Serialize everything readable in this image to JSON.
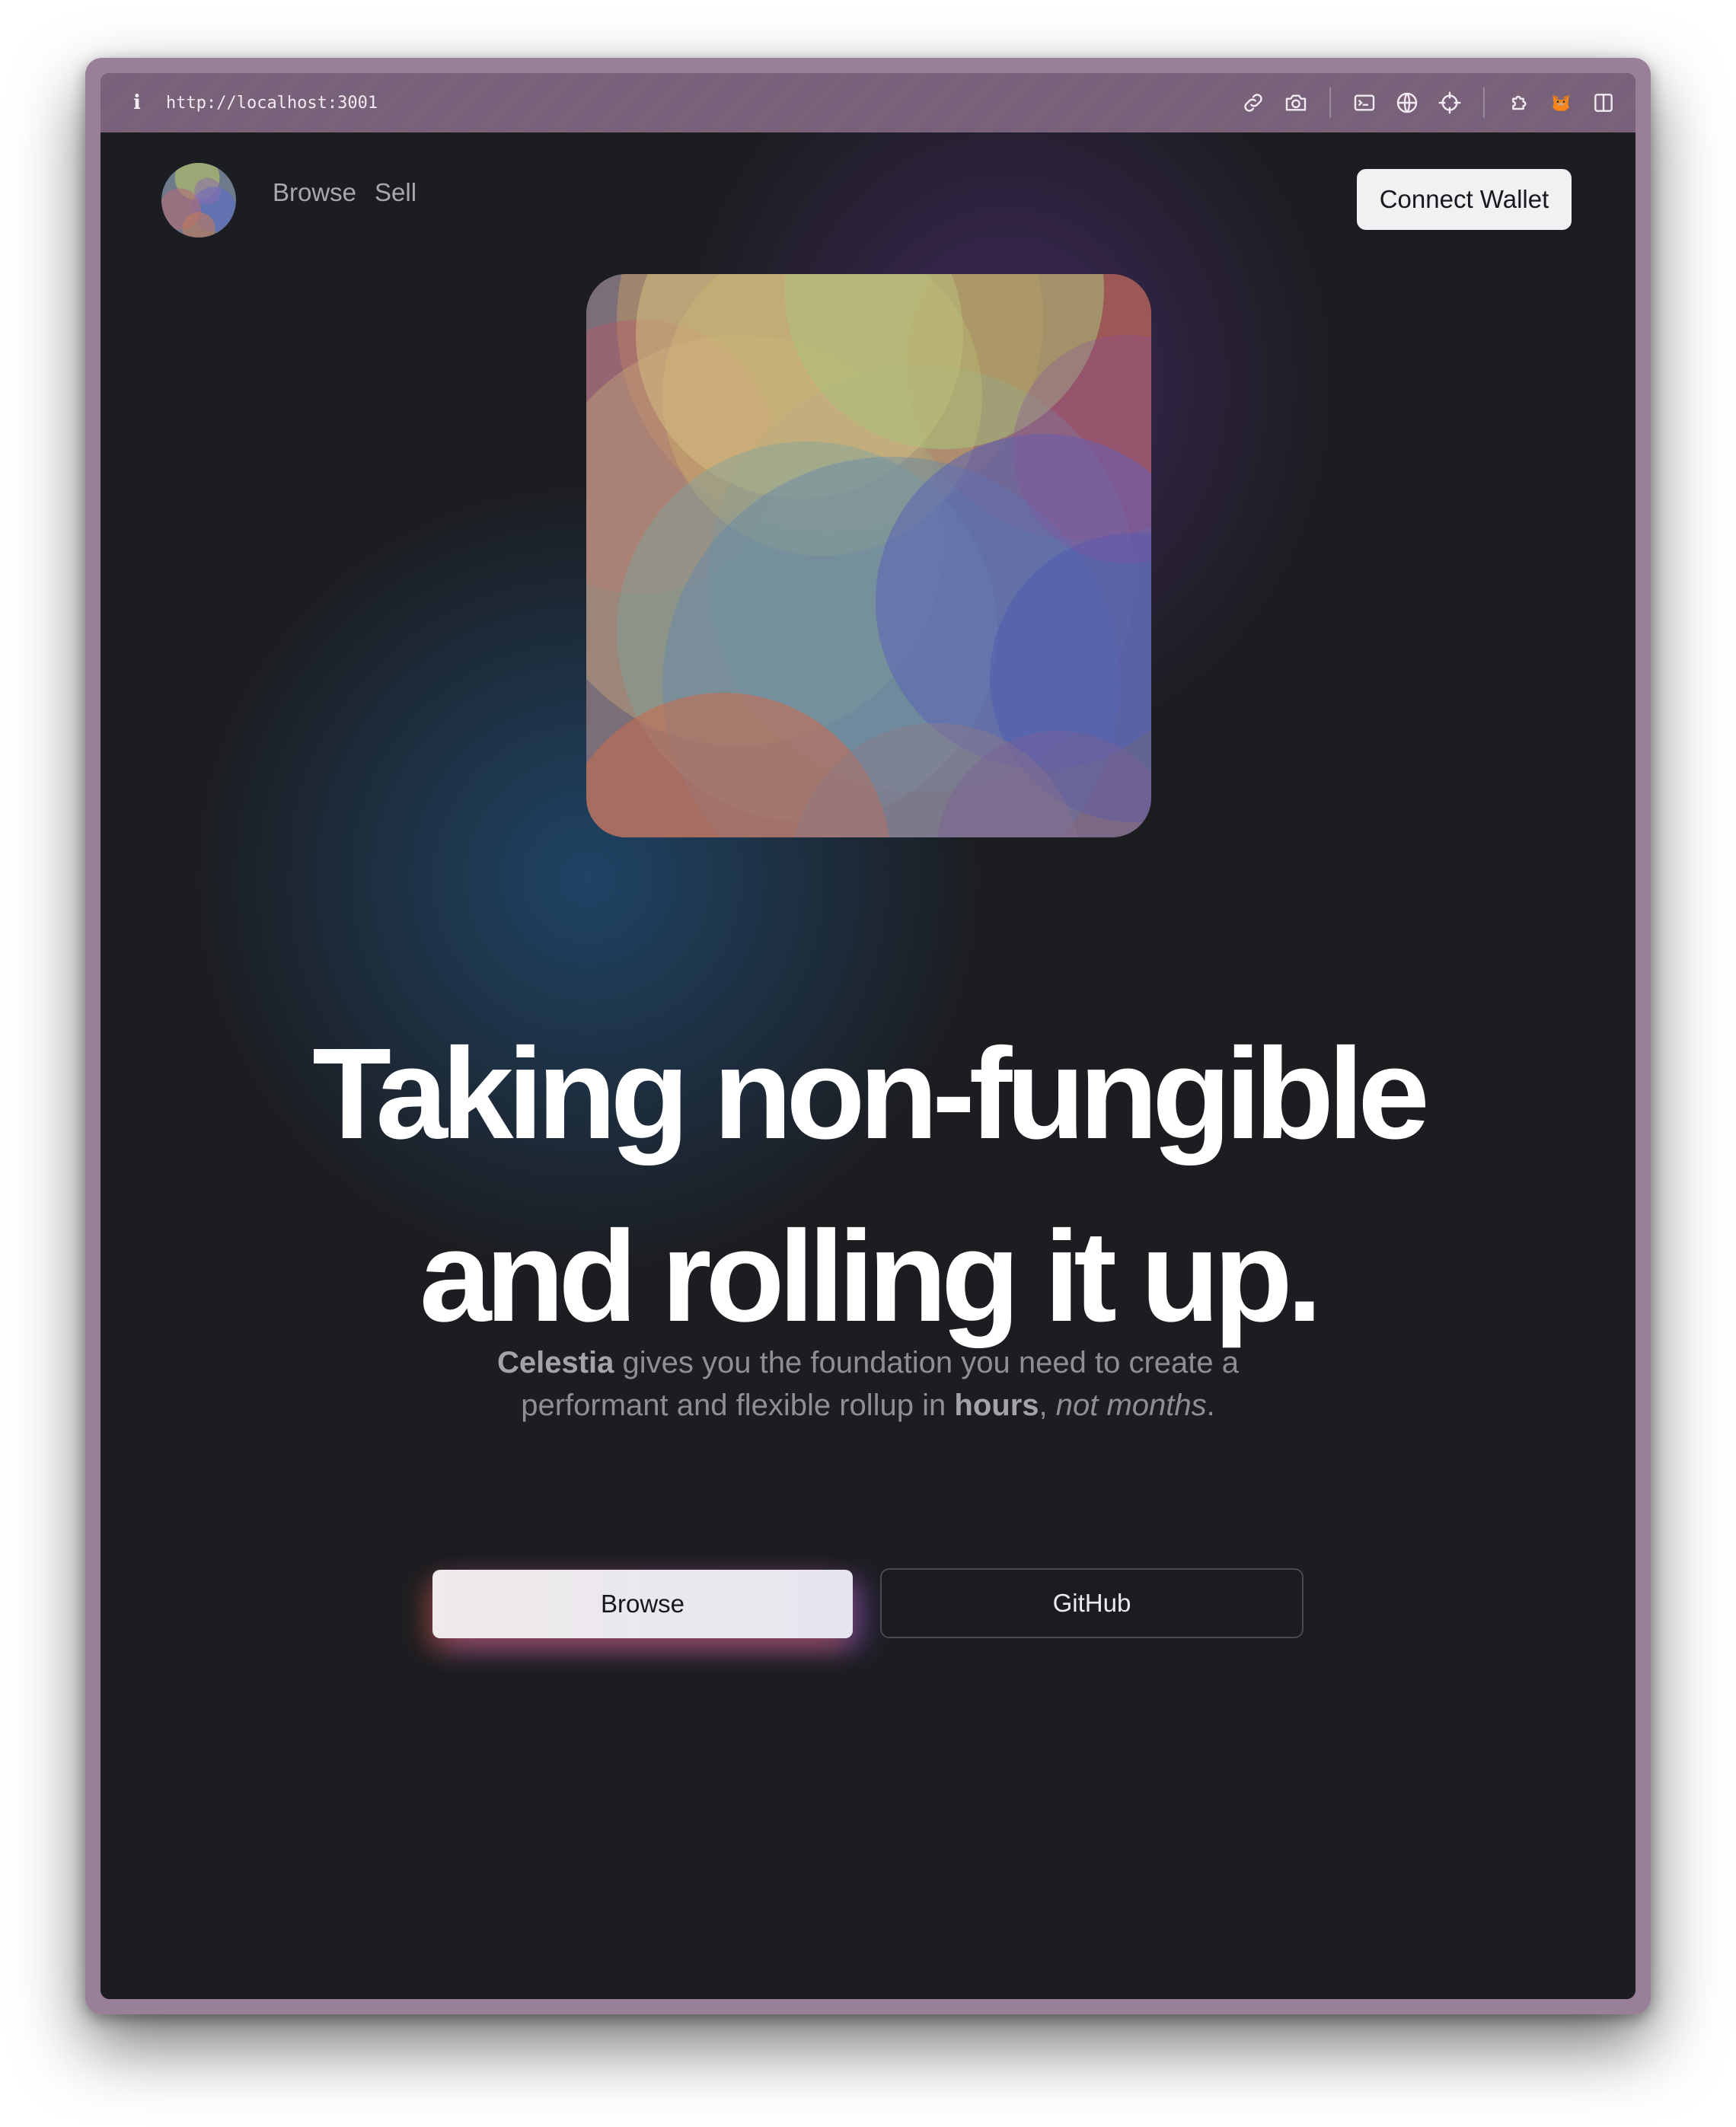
{
  "browser": {
    "url": "http://localhost:3001",
    "toolbar_icons": [
      "info-icon",
      "link-icon",
      "camera-icon",
      "terminal-icon",
      "globe-icon",
      "crosshair-icon",
      "extensions-icon",
      "metamask-fox-icon",
      "sidebar-toggle-icon"
    ]
  },
  "nav": {
    "links": [
      {
        "label": "Browse"
      },
      {
        "label": "Sell"
      }
    ],
    "connect_wallet": "Connect Wallet"
  },
  "hero": {
    "headline_line1": "Taking non-fungible",
    "headline_line2": "and rolling it up.",
    "tagline": {
      "brand": "Celestia",
      "part1": " gives you the foundation you need to create a",
      "part2": "performant and flexible rollup in ",
      "emphasis": "hours",
      "comma": ", ",
      "italic": "not months",
      "period": "."
    },
    "buttons": {
      "primary": "Browse",
      "secondary": "GitHub"
    }
  },
  "colors": {
    "frame": "#9a7f98",
    "page_bg": "#1c1d21",
    "headline": "#ffffff",
    "button_light": "#f1f1f3"
  }
}
